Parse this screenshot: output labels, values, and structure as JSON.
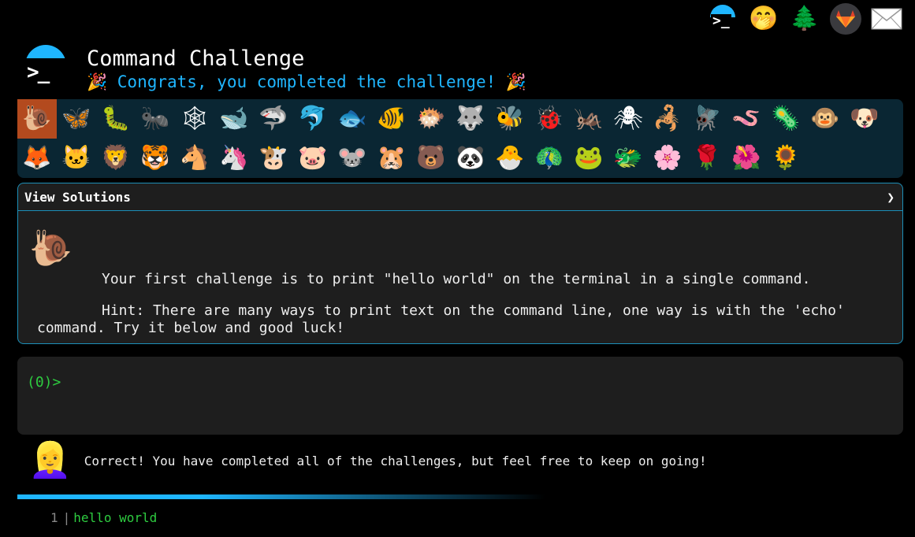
{
  "app": {
    "title": "Command Challenge",
    "subtitle": "🎉 Congrats, you completed the challenge! 🎉"
  },
  "topbar": [
    {
      "name": "command-challenge-logo-icon",
      "glyph": "logo"
    },
    {
      "name": "face-with-hand-over-mouth-icon",
      "glyph": "🤭"
    },
    {
      "name": "evergreen-tree-icon",
      "glyph": "🌲"
    },
    {
      "name": "gitlab-icon",
      "glyph": "gitlab"
    },
    {
      "name": "envelope-icon",
      "glyph": "✉"
    }
  ],
  "levels": [
    {
      "name": "snail",
      "glyph": "🐌",
      "active": true
    },
    {
      "name": "butterfly",
      "glyph": "🦋"
    },
    {
      "name": "caterpillar",
      "glyph": "🐛"
    },
    {
      "name": "ant",
      "glyph": "🐜"
    },
    {
      "name": "spider-web",
      "glyph": "🕸"
    },
    {
      "name": "whale",
      "glyph": "🐋"
    },
    {
      "name": "shark",
      "glyph": "🦈"
    },
    {
      "name": "dolphin",
      "glyph": "🐬"
    },
    {
      "name": "fish",
      "glyph": "🐟"
    },
    {
      "name": "tropical-fish",
      "glyph": "🐠"
    },
    {
      "name": "blowfish",
      "glyph": "🐡"
    },
    {
      "name": "wolf",
      "glyph": "🐺"
    },
    {
      "name": "bee",
      "glyph": "🐝"
    },
    {
      "name": "ladybug",
      "glyph": "🐞"
    },
    {
      "name": "cricket",
      "glyph": "🦗"
    },
    {
      "name": "spider",
      "glyph": "🕷"
    },
    {
      "name": "scorpion",
      "glyph": "🦂"
    },
    {
      "name": "fly",
      "glyph": "🪰"
    },
    {
      "name": "worm",
      "glyph": "🪱"
    },
    {
      "name": "microbe",
      "glyph": "🦠"
    },
    {
      "name": "monkey",
      "glyph": "🐵"
    },
    {
      "name": "dog",
      "glyph": "🐶"
    },
    {
      "name": "fox",
      "glyph": "🦊"
    },
    {
      "name": "cat",
      "glyph": "🐱"
    },
    {
      "name": "lion",
      "glyph": "🦁"
    },
    {
      "name": "tiger",
      "glyph": "🐯"
    },
    {
      "name": "horse",
      "glyph": "🐴"
    },
    {
      "name": "unicorn",
      "glyph": "🦄"
    },
    {
      "name": "cow",
      "glyph": "🐮"
    },
    {
      "name": "pig",
      "glyph": "🐷"
    },
    {
      "name": "mouse",
      "glyph": "🐭"
    },
    {
      "name": "hamster",
      "glyph": "🐹"
    },
    {
      "name": "bear",
      "glyph": "🐻"
    },
    {
      "name": "panda",
      "glyph": "🐼"
    },
    {
      "name": "hatching-chick",
      "glyph": "🐣"
    },
    {
      "name": "peacock",
      "glyph": "🦚"
    },
    {
      "name": "frog",
      "glyph": "🐸"
    },
    {
      "name": "dragon",
      "glyph": "🐲"
    },
    {
      "name": "cherry-blossom",
      "glyph": "🌸"
    },
    {
      "name": "rose",
      "glyph": "🌹"
    },
    {
      "name": "flower",
      "glyph": "🌺"
    },
    {
      "name": "sunflower",
      "glyph": "🌻"
    }
  ],
  "panel": {
    "header": "View Solutions",
    "chevron": "❯",
    "challenge_icon": "🐌",
    "challenge": "Your first challenge is to print \"hello world\" on the terminal in a single command.",
    "hint": "Hint: There are many ways to print text on the command line, one way is with the 'echo' command. Try it below and good luck!"
  },
  "terminal": {
    "prompt": "(0)>"
  },
  "feedback": {
    "avatar": "👱‍♀️",
    "message": "Correct! You have completed all of the challenges, but feel free to keep on going!"
  },
  "history": [
    {
      "line": "1",
      "command": "hello world"
    }
  ],
  "colors": {
    "accent": "#1fb6ff",
    "panel_border": "#1c8fb8",
    "level_bar_bg": "#0a2633",
    "active_level": "#b34a1e",
    "prompt_green": "#2ecc40",
    "panel_bg": "#1e1e1e"
  }
}
